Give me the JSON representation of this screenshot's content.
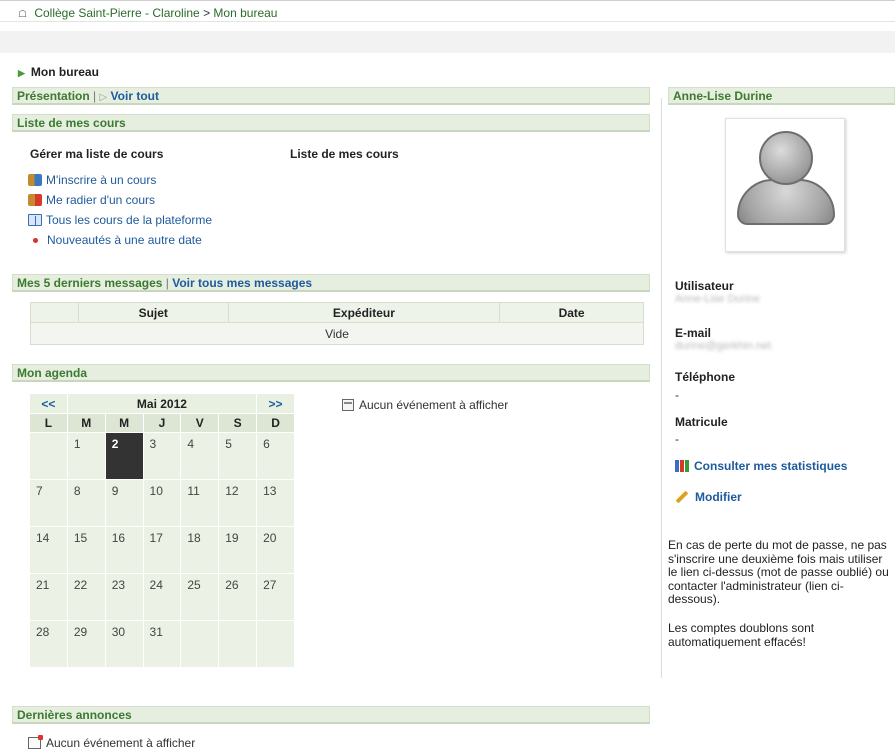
{
  "breadcrumb": {
    "home": "Collège Saint-Pierre - Claroline",
    "separator": ">",
    "current": "Mon bureau"
  },
  "page_title": "Mon bureau",
  "presentation_bar": {
    "presentation": "Présentation",
    "sep": "|",
    "voir_tout": "Voir tout"
  },
  "courses": {
    "header": "Liste de mes cours",
    "manage_title": "Gérer ma liste de cours",
    "list_title": "Liste de mes cours",
    "links": [
      "M'inscrire à un cours",
      "Me radier d'un cours",
      "Tous les cours de la plateforme",
      "Nouveautés à une autre date"
    ]
  },
  "messages": {
    "header_left": "Mes 5 derniers messages",
    "sep": "|",
    "header_link": "Voir tous mes messages",
    "columns": [
      "",
      "Sujet",
      "Expéditeur",
      "Date"
    ],
    "empty": "Vide"
  },
  "agenda": {
    "header": "Mon agenda",
    "prev": "<<",
    "next": ">>",
    "month": "Mai 2012",
    "days": [
      "L",
      "M",
      "M",
      "J",
      "V",
      "S",
      "D"
    ],
    "weeks": [
      [
        "",
        "1",
        "2",
        "3",
        "4",
        "5",
        "6"
      ],
      [
        "7",
        "8",
        "9",
        "10",
        "11",
        "12",
        "13"
      ],
      [
        "14",
        "15",
        "16",
        "17",
        "18",
        "19",
        "20"
      ],
      [
        "21",
        "22",
        "23",
        "24",
        "25",
        "26",
        "27"
      ],
      [
        "28",
        "29",
        "30",
        "31",
        "",
        "",
        ""
      ]
    ],
    "today": "2",
    "no_event": "Aucun événement à afficher"
  },
  "announcements": {
    "header": "Dernières annonces",
    "no_event": "Aucun événement à afficher"
  },
  "user": {
    "name": "Anne-Lise Durine",
    "label_user": "Utilisateur",
    "user_value": "Anne-Lise Durine",
    "label_email": "E-mail",
    "email_value": "durine@gerkhin.net",
    "label_phone": "Téléphone",
    "phone_value": "-",
    "label_id": "Matricule",
    "id_value": "-",
    "stats_link": "Consulter mes statistiques",
    "edit_link": "Modifier",
    "help_text_1": "En cas de perte du mot de passe, ne pas s'inscrire une deuxième fois mais utiliser le lien ci-dessus (mot de passe oublié) ou contacter l'administrateur (lien ci-dessous).",
    "help_text_2": "Les comptes doublons sont automatiquement effacés!"
  },
  "colors": {
    "header_bg": "#e6eedf",
    "header_text": "#3b7a2f",
    "link": "#1e5a9c",
    "today_cell": "#333333"
  }
}
